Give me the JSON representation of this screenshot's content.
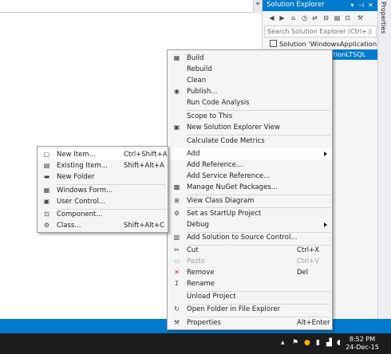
{
  "solution_explorer": {
    "title": "Solution Explorer",
    "title_buttons": {
      "dropdown": "▾",
      "pin": "⊣",
      "close": "✕"
    },
    "toolbar_icons": [
      "back-icon",
      "forward-icon",
      "home-icon",
      "history-icon",
      "sync-icon",
      "collapse-icon",
      "properties-icon",
      "preview-icon",
      "wrench-icon"
    ],
    "search_placeholder": "Search Solution Explorer (Ctrl+;)",
    "tree": [
      {
        "label": "Solution 'WindowsApplicationLTSQ",
        "selected": false
      },
      {
        "label": "WindowsApplicationLTSQL",
        "selected": true
      }
    ]
  },
  "side_tab": {
    "label": "Properties"
  },
  "context_menu": {
    "items": [
      {
        "icon": "build-icon",
        "label": "Build"
      },
      {
        "label": "Rebuild"
      },
      {
        "label": "Clean"
      },
      {
        "icon": "publish-icon",
        "label": "Publish..."
      },
      {
        "label": "Run Code Analysis"
      },
      {
        "label": "Scope to This"
      },
      {
        "icon": "new-view-icon",
        "label": "New Solution Explorer View"
      },
      {
        "label": "Calculate Code Metrics"
      },
      {
        "label": "Add",
        "has_submenu": true
      },
      {
        "label": "Add Reference..."
      },
      {
        "label": "Add Service Reference..."
      },
      {
        "icon": "nuget-icon",
        "label": "Manage NuGet Packages..."
      },
      {
        "icon": "class-diagram-icon",
        "label": "View Class Diagram"
      },
      {
        "icon": "gear-icon",
        "label": "Set as StartUp Project"
      },
      {
        "label": "Debug",
        "has_submenu": true
      },
      {
        "icon": "source-control-icon",
        "label": "Add Solution to Source Control..."
      },
      {
        "icon": "scissors-icon",
        "label": "Cut",
        "shortcut": "Ctrl+X"
      },
      {
        "icon": "paste-icon",
        "label": "Paste",
        "shortcut": "Ctrl+V",
        "disabled": true
      },
      {
        "icon": "remove-icon",
        "label": "Remove",
        "shortcut": "Del"
      },
      {
        "icon": "rename-icon",
        "label": "Rename"
      },
      {
        "label": "Unload Project"
      },
      {
        "icon": "refresh-arrow-icon",
        "label": "Open Folder in File Explorer"
      },
      {
        "icon": "wrench-icon",
        "label": "Properties",
        "shortcut": "Alt+Enter"
      }
    ]
  },
  "add_submenu": {
    "items": [
      {
        "icon": "new-item-icon",
        "label": "New Item...",
        "shortcut": "Ctrl+Shift+A"
      },
      {
        "icon": "existing-item-icon",
        "label": "Existing Item...",
        "shortcut": "Shift+Alt+A"
      },
      {
        "icon": "new-folder-icon",
        "label": "New Folder"
      },
      {
        "icon": "windows-form-icon",
        "label": "Windows Form..."
      },
      {
        "icon": "user-control-icon",
        "label": "User Control..."
      },
      {
        "icon": "component-icon",
        "label": "Component..."
      },
      {
        "icon": "class-icon",
        "label": "Class...",
        "shortcut": "Shift+Alt+C"
      }
    ]
  },
  "taskbar": {
    "time": "8:52 PM",
    "date": "24-Dec-15",
    "tray_icons": [
      "up-arrow-icon",
      "flag-icon",
      "network-app-icon",
      "battery-icon",
      "signal-icon",
      "volume-icon"
    ]
  },
  "colors": {
    "accent": "#007acc",
    "menu_bg": "#f5f5f5",
    "taskbar": "#1c1c1c"
  }
}
